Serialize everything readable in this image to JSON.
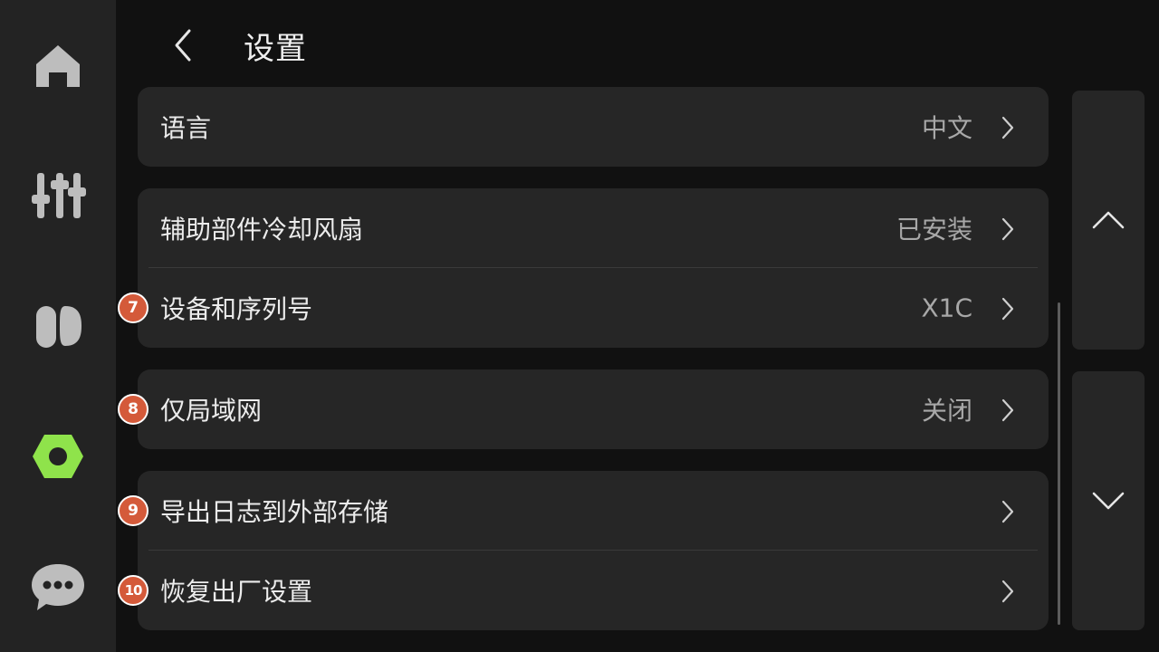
{
  "header": {
    "title": "设置"
  },
  "sidebar": {
    "items": [
      {
        "icon": "home-icon"
      },
      {
        "icon": "control-sliders-icon"
      },
      {
        "icon": "filament-icon"
      },
      {
        "icon": "settings-nut-icon",
        "active": true
      },
      {
        "icon": "chat-bubble-icon"
      }
    ],
    "active_color": "#8fe34b"
  },
  "settings": {
    "language": {
      "label": "语言",
      "value": "中文"
    },
    "aux_fan": {
      "label": "辅助部件冷却风扇",
      "value": "已安装"
    },
    "device": {
      "label": "设备和序列号",
      "value": "X1C",
      "badge": "7"
    },
    "lan_only": {
      "label": "仅局域网",
      "value": "关闭",
      "badge": "8"
    },
    "export_logs": {
      "label": "导出日志到外部存储",
      "badge": "9"
    },
    "factory_reset": {
      "label": "恢复出厂设置",
      "badge": "10"
    }
  },
  "colors": {
    "badge": "#d45a3a",
    "card": "#262626",
    "background": "#111111"
  }
}
